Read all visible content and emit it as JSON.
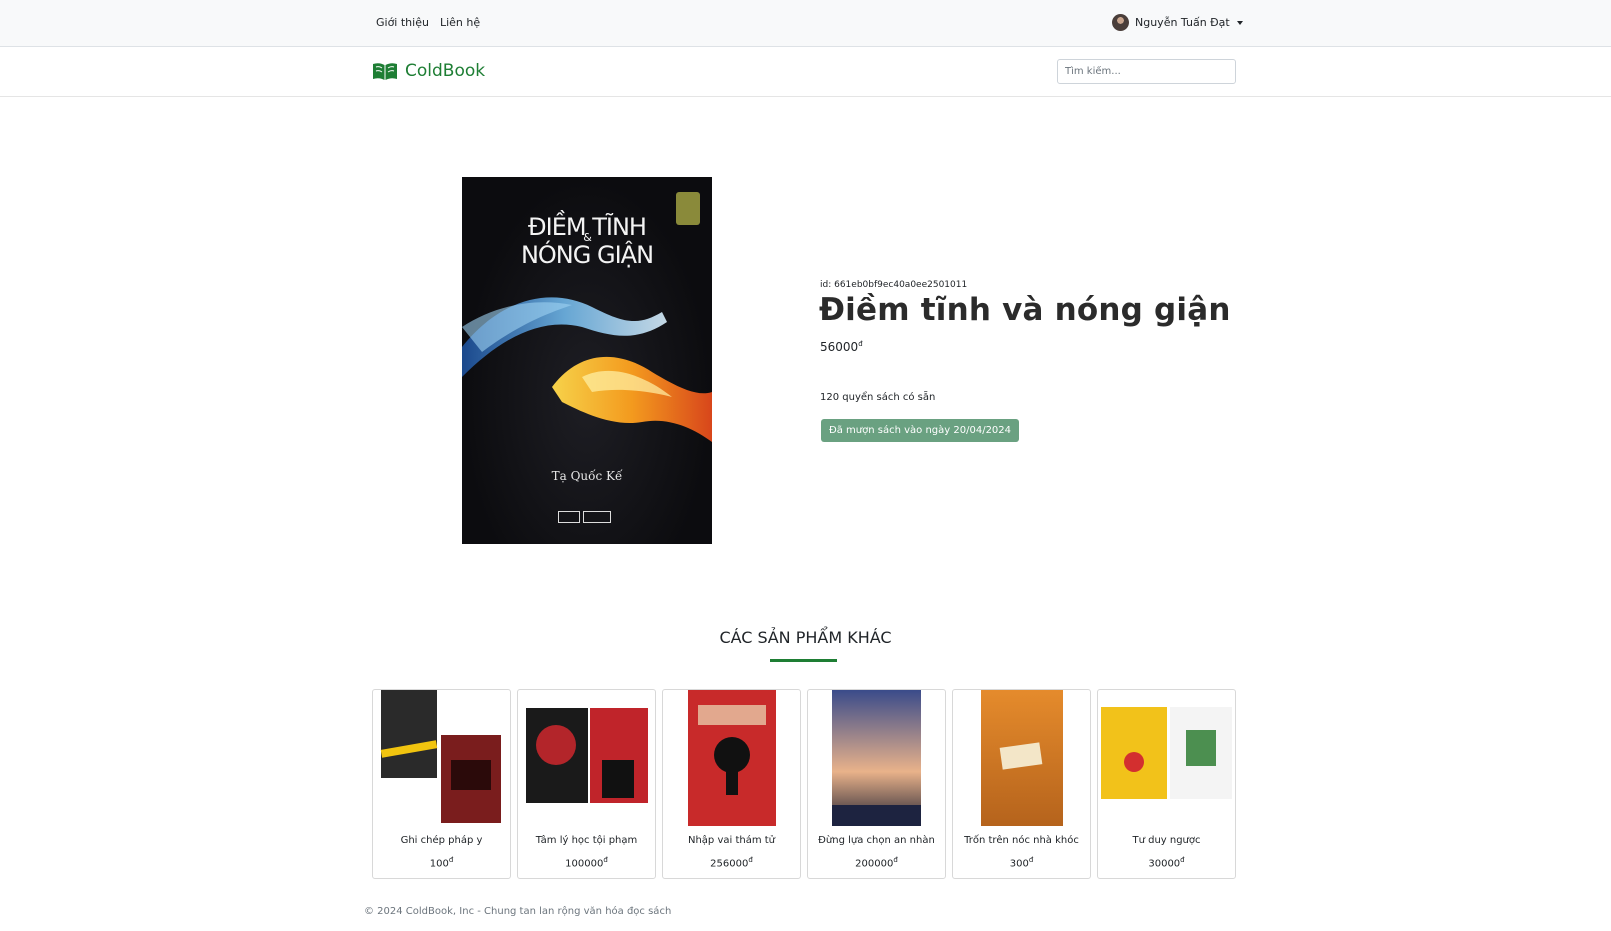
{
  "topnav": {
    "links": [
      "Giới thiệu",
      "Liên hệ"
    ],
    "user_name": "Nguyễn Tuấn Đạt"
  },
  "nav": {
    "brand": "ColdBook",
    "search_placeholder": "Tìm kiếm..."
  },
  "book": {
    "id_text": "id: 661eb0bf9ec40a0ee2501011",
    "title": "Điềm tĩnh và nóng giận",
    "price": "56000",
    "currency": "đ",
    "stock_text": "120 quyển sách có sẵn",
    "borrow_text": "Đã mượn sách vào ngày 20/04/2024",
    "cover": {
      "line1": "ĐIỀM TĨNH",
      "amp": "&",
      "line2": "NÓNG GIẬN",
      "author": "Tạ Quốc Kế"
    }
  },
  "related": {
    "heading": "CÁC SẢN PHẨM KHÁC",
    "items": [
      {
        "name": "Ghi chép pháp y",
        "price": "100"
      },
      {
        "name": "Tâm lý học tội phạm",
        "price": "100000"
      },
      {
        "name": "Nhập vai thám tử",
        "price": "256000"
      },
      {
        "name": "Đừng lựa chọn an nhàn",
        "price": "200000"
      },
      {
        "name": "Trốn trên nóc nhà khóc",
        "price": "300"
      },
      {
        "name": "Tư duy ngược",
        "price": "30000"
      }
    ]
  },
  "footer": {
    "text": "© 2024 ColdBook, Inc - Chung tan lan rộng văn hóa đọc sách"
  },
  "colors": {
    "brand": "#1e7e34",
    "badge": "#6aa181"
  }
}
